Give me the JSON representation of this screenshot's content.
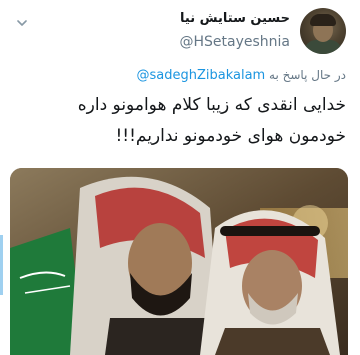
{
  "author": {
    "display_name": "حسین ستایش نیا",
    "handle": "@HSetayeshnia"
  },
  "reply": {
    "prefix": "در حال پاسخ به",
    "mention": "@sadeghZibakalam"
  },
  "tweet": {
    "line1": "خدایی انقدی که زیبا کلام هوامونو داره",
    "line2": "خودمون هوای خودمونو نداریم!!!"
  },
  "icons": {
    "menu": "chevron-down-icon",
    "avatar": "avatar-image",
    "photo": "photo"
  },
  "colors": {
    "link": "#1b95e0",
    "secondary_text": "#657786",
    "primary_text": "#14171a"
  }
}
